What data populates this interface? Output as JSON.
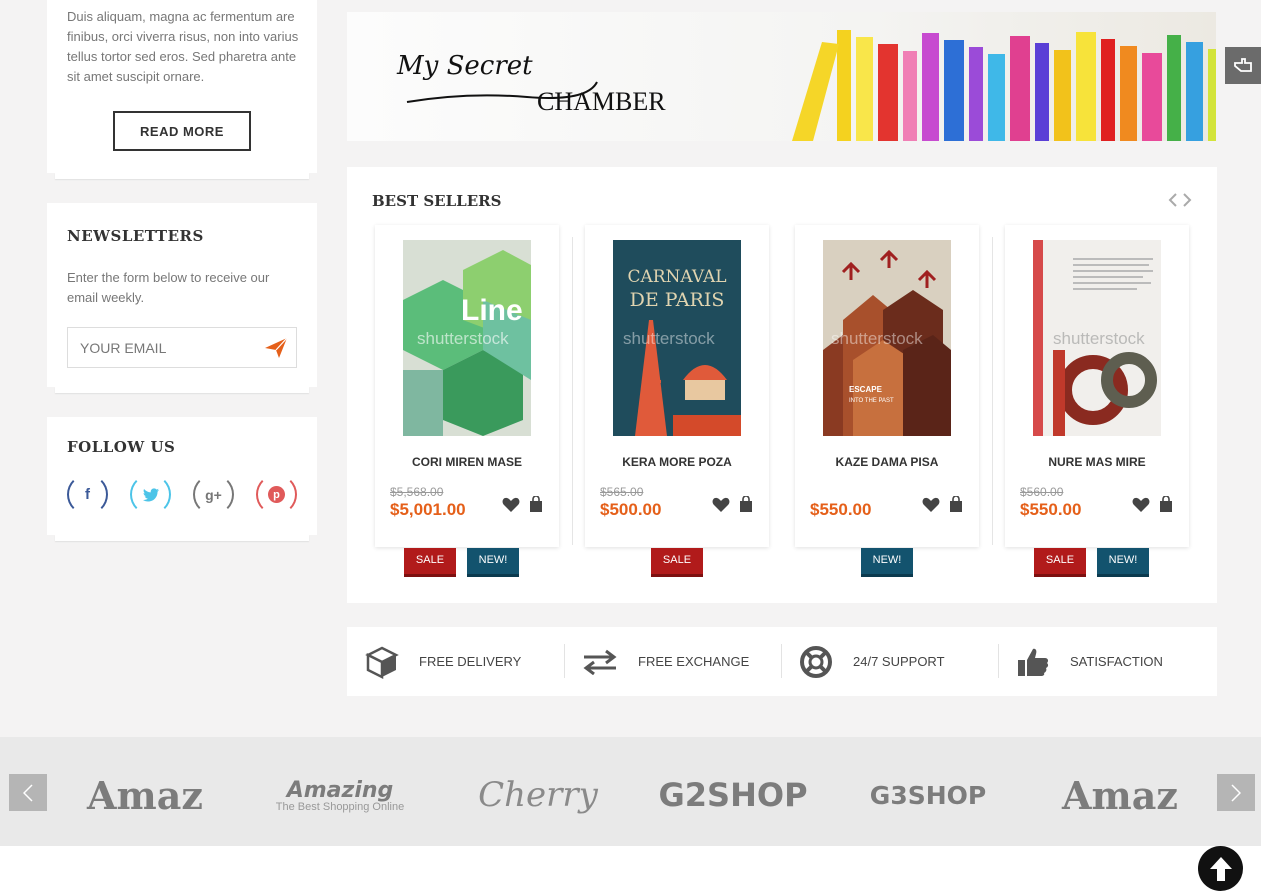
{
  "sidebar": {
    "about_text": "Duis aliquam, magna ac fermentum are finibus, orci viverra risus, non into varius tellus tortor sed eros. Sed pharetra ante sit amet suscipit ornare.",
    "read_more_label": "READ MORE",
    "newsletter": {
      "title": "NEWSLETTERS",
      "text": "Enter the form below to receive our email weekly.",
      "email_placeholder": "YOUR EMAIL"
    },
    "follow": {
      "title": "FOLLOW US",
      "networks": [
        "facebook-icon",
        "twitter-icon",
        "google-plus-icon",
        "pinterest-icon"
      ],
      "icons": {
        "facebook": "f",
        "googleplus": "g+"
      }
    }
  },
  "banner": {
    "brand_script": "My Secret",
    "brand_caps": "CHAMBER"
  },
  "best_sellers": {
    "title": "BEST SELLERS",
    "products": [
      {
        "name": "CORI MIREN MASE",
        "old_price": "$5,568.00",
        "price": "$5,001.00",
        "badges": [
          "SALE",
          "NEW!"
        ]
      },
      {
        "name": "KERA MORE POZA",
        "old_price": "$565.00",
        "price": "$500.00",
        "badges": [
          "SALE"
        ]
      },
      {
        "name": "KAZE DAMA PISA",
        "old_price": "",
        "price": "$550.00",
        "badges": [
          "NEW!"
        ]
      },
      {
        "name": "NURE MAS MIRE",
        "old_price": "$560.00",
        "price": "$550.00",
        "badges": [
          "SALE",
          "NEW!"
        ]
      }
    ],
    "cover_text": {
      "p1_title": "Line",
      "watermark": "shutterstock",
      "p2_title_1": "CARNAVAL",
      "p2_title_2": "DE PARIS",
      "p3_text_1": "ESCAPE",
      "p3_text_2": "INTO THE PAST"
    }
  },
  "features": [
    {
      "label": "FREE DELIVERY",
      "icon": "box-icon"
    },
    {
      "label": "FREE EXCHANGE",
      "icon": "exchange-arrows-icon"
    },
    {
      "label": "24/7 SUPPORT",
      "icon": "lifebuoy-icon"
    },
    {
      "label": "SATISFACTION",
      "icon": "thumbs-up-icon"
    }
  ],
  "brands": [
    {
      "name": "Amaz"
    },
    {
      "name": "Amazing",
      "tagline": "The Best Shopping Online"
    },
    {
      "name": "Cherry"
    },
    {
      "name": "G2SHOP"
    },
    {
      "name": "G3SHOP"
    },
    {
      "name": "Amaz"
    }
  ],
  "colors": {
    "accent": "#e5601a",
    "sale": "#b11b1b",
    "new": "#13536e"
  }
}
